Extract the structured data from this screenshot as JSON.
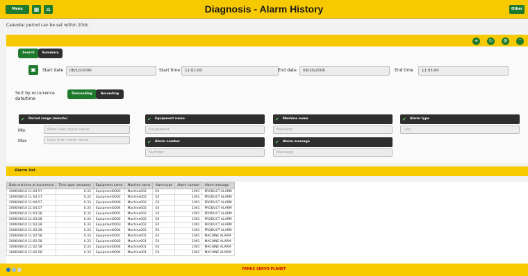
{
  "header": {
    "title": "Diagnosis - Alarm History",
    "menu_label": "Menu",
    "left_icons": [
      "grid-icon",
      "home-icon"
    ],
    "right_label": "Other"
  },
  "note": "Calendar period can be set within 20ds .",
  "toolbar": {
    "icons": [
      "plus-icon",
      "refresh-icon",
      "settings-icon",
      "up-icon"
    ]
  },
  "search_tabs": [
    "Search",
    "Summary"
  ],
  "dates": {
    "start_date_label": "Start date",
    "start_date_value": "08/10/2006",
    "start_time_label": "Start time",
    "start_time_value": "11:01:00",
    "end_date_label": "End date",
    "end_date_value": "08/10/2006",
    "end_time_label": "End time",
    "end_time_value": "11:05:00"
  },
  "sort": {
    "label": "Sort by occurrence date/time",
    "options": [
      "Descending",
      "Ascending"
    ]
  },
  "filters": {
    "period_range": {
      "label": "Period range (minute)",
      "min_label": "Min",
      "max_label": "Max",
      "min_placeholder": "More than input value",
      "max_placeholder": "Less than input value"
    },
    "equipment_name": {
      "label": "Equipment name",
      "placeholder": "Equipment"
    },
    "machine_name": {
      "label": "Machine name",
      "placeholder": "Machine"
    },
    "alarm_type": {
      "label": "Alarm type",
      "placeholder": "Use"
    },
    "alarm_number": {
      "label": "Alarm number",
      "placeholder": "Number"
    },
    "alarm_message": {
      "label": "Alarm message",
      "placeholder": "Message"
    }
  },
  "alarm_list_title": "Alarm list",
  "table": {
    "columns": [
      "Date and time of occurrence",
      "Time span (minutes)",
      "Equipment name",
      "Machine name",
      "Alarm type",
      "Alarm number",
      "Alarm message"
    ],
    "rows": [
      [
        "2006/08/10 11:04:57",
        "0.33",
        "Equipment0002",
        "Machine002",
        "EX",
        "1001",
        "PRODUCT ALARM"
      ],
      [
        "2006/08/10 11:04:57",
        "0.33",
        "Equipment0002",
        "Machine002",
        "EX",
        "1001",
        "PRODUCT ALARM"
      ],
      [
        "2006/08/10 11:04:57",
        "0.33",
        "Equipment0006",
        "Machine002",
        "EX",
        "1001",
        "PRODUCT ALARM"
      ],
      [
        "2006/08/10 11:04:57",
        "0.33",
        "Equipment0004",
        "Machine002",
        "EX",
        "1001",
        "PRODUCT ALARM"
      ],
      [
        "2006/08/10 11:03:28",
        "0.33",
        "Equipment0001",
        "Machine002",
        "EX",
        "1001",
        "PRODUCT ALARM"
      ],
      [
        "2006/08/10 11:03:28",
        "0.33",
        "Equipment0002",
        "Machine002",
        "EX",
        "1001",
        "PRODUCT ALARM"
      ],
      [
        "2006/08/10 11:03:28",
        "0.33",
        "Equipment0003",
        "Machine002",
        "EX",
        "1001",
        "PRODUCT ALARM"
      ],
      [
        "2006/08/10 11:03:28",
        "0.33",
        "Equipment0004",
        "Machine002",
        "EX",
        "1001",
        "PRODUCT ALARM"
      ],
      [
        "2006/08/10 11:02:58",
        "0.33",
        "Equipment0001",
        "Machine001",
        "EX",
        "1001",
        "MACHINE ALARM"
      ],
      [
        "2006/08/10 11:02:58",
        "0.33",
        "Equipment0002",
        "Machine001",
        "EX",
        "1001",
        "MACHINE ALARM"
      ],
      [
        "2006/08/10 11:02:58",
        "0.33",
        "Equipment0004",
        "Machine001",
        "EX",
        "1001",
        "MACHINE ALARM"
      ],
      [
        "2006/08/10 11:02:58",
        "0.33",
        "Equipment0004",
        "Machine001",
        "EX",
        "1001",
        "MACHINE ALARM"
      ]
    ]
  },
  "footer": {
    "brand": "FANUC SERVO PLANET"
  },
  "colors": {
    "accent_yellow": "#f7c900",
    "accent_green": "#1f7a2e",
    "dark": "#2e2e2e"
  }
}
